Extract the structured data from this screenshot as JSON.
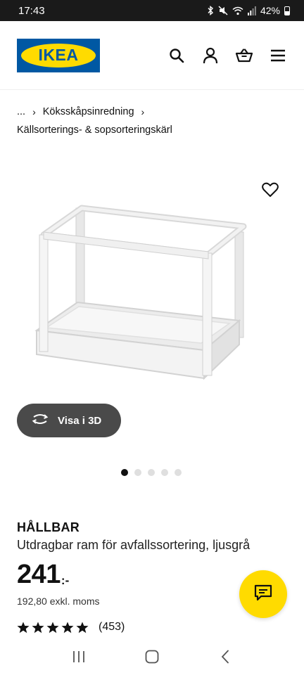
{
  "status_bar": {
    "time": "17:43",
    "battery": "42%",
    "icons": [
      "bluetooth-icon",
      "mute-icon",
      "wifi-icon",
      "signal-icon",
      "battery-icon"
    ]
  },
  "header": {
    "logo_text": "IKEA",
    "icons": [
      "search-icon",
      "account-icon",
      "cart-icon",
      "menu-icon"
    ]
  },
  "breadcrumb": {
    "ellipsis": "...",
    "separator": "›",
    "parent": "Köksskåpsinredning",
    "current": "Källsorterings- & sopsorteringskärl"
  },
  "product_image": {
    "favorite_icon": "heart-icon",
    "view3d_label": "Visa i 3D",
    "view3d_icon": "rotate-3d-icon",
    "carousel": {
      "count": 5,
      "active": 0
    }
  },
  "product": {
    "name": "HÅLLBAR",
    "description": "Utdragbar ram för avfallssortering, ljusgrå",
    "price": "241",
    "price_suffix": ":-",
    "price_ex_vat": "192,80 exkl. moms",
    "rating": 5,
    "review_count": "(453)"
  },
  "chat": {
    "icon": "chat-icon"
  },
  "nav_bar": {
    "icons": [
      "recent-apps-icon",
      "home-icon",
      "back-icon"
    ]
  },
  "colors": {
    "ikea_blue": "#0058a3",
    "ikea_yellow": "#ffdb00",
    "status_bg": "#1a1a1a",
    "view3d_bg": "#4a4a4a"
  }
}
